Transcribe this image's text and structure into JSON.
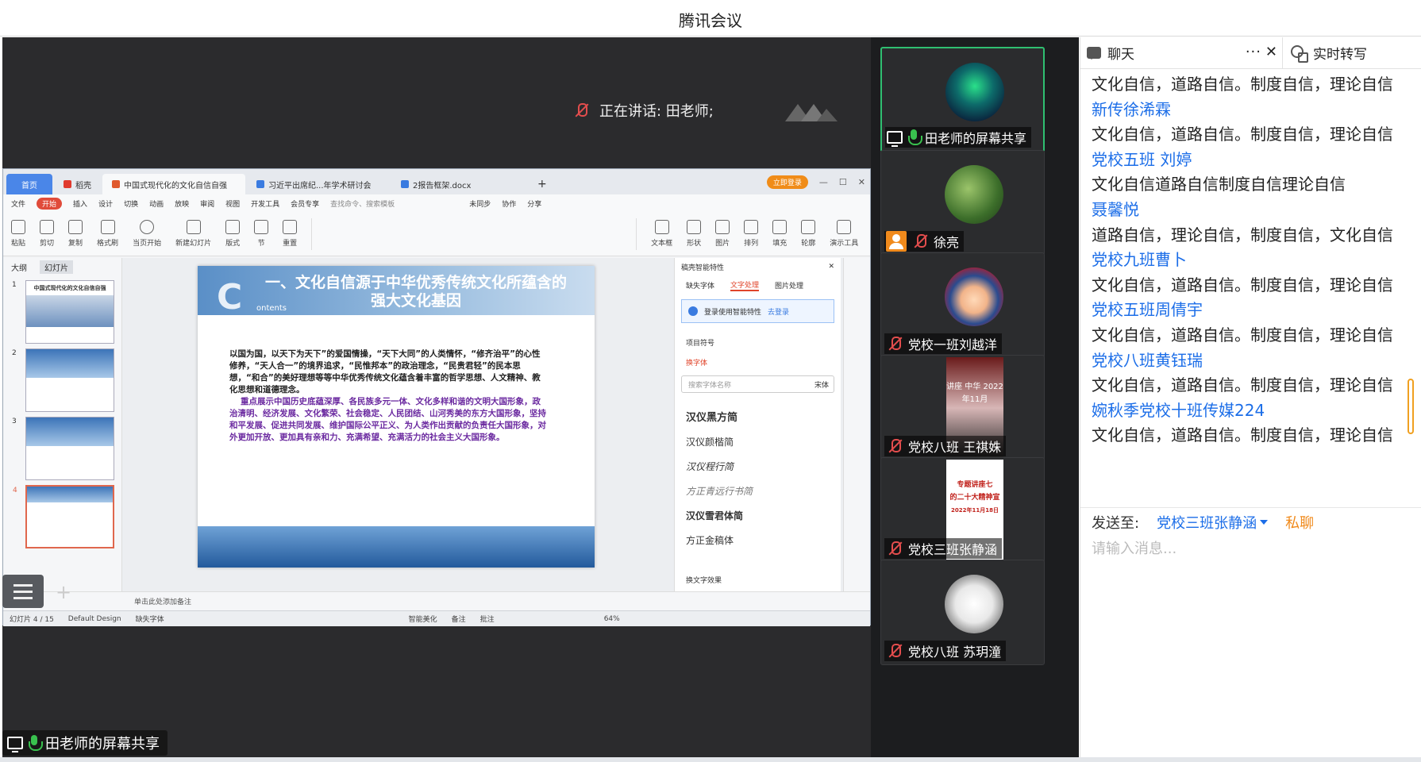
{
  "window": {
    "title": "腾讯会议"
  },
  "stage": {
    "speaking": "正在讲话: 田老师;",
    "share_label": "田老师的屏幕共享"
  },
  "wps": {
    "tabs": [
      "首页",
      "稻壳",
      "中国式现代化的文化自信自强",
      "习近平出席纪...年学术研讨会",
      "2报告框架.docx"
    ],
    "login": "立即登录",
    "menus": [
      "文件",
      "开始",
      "插入",
      "设计",
      "切换",
      "动画",
      "放映",
      "审阅",
      "视图",
      "开发工具",
      "会员专享",
      "查找命令、搜索模板"
    ],
    "menu_right": [
      "未同步",
      "协作",
      "分享"
    ],
    "ribbon": [
      "粘贴",
      "剪切",
      "复制",
      "格式刷",
      "当页开始",
      "新建幻灯片",
      "版式",
      "节",
      "重置",
      "文本框",
      "形状",
      "图片",
      "排列",
      "填充",
      "轮廓",
      "演示工具"
    ],
    "thumb_tabs": [
      "大纲",
      "幻灯片"
    ],
    "thumb_title": "中国式现代化的文化自信自强",
    "slide": {
      "title": "一、文化自信源于中华优秀传统文化所蕴含的强大文化基因",
      "big_c": "C",
      "ontents": "ontents",
      "para1": "以国为国，以天下为天下”的爱国情操，“天下大同”的人类情怀，“修齐治平”的心性修养，“天人合一”的境界追求，“民惟邦本”的政治理念，“民贵君轻”的民本思想，“和合”的美好理想等等中华优秀传统文化蕴含着丰富的哲学思想、人文精神、教化思想和道德理念。",
      "para2": "重点展示中国历史底蕴深厚、各民族多元一体、文化多样和谐的文明大国形象，政治清明、经济发展、文化繁荣、社会稳定、人民团结、山河秀美的东方大国形象，坚持和平发展、促进共同发展、维护国际公平正义、为人类作出贡献的负责任大国形象，对外更加开放、更加具有亲和力、充满希望、充满活力的社会主义大国形象。"
    },
    "panel": {
      "title": "稿壳智能特性",
      "tabs": [
        "缺失字体",
        "文字处理",
        "图片处理"
      ],
      "info": "登录使用智能特性",
      "info_link": "去登录",
      "item1": "项目符号",
      "item2": "换字体",
      "search_placeholder": "搜索字体名称",
      "search_font": "宋体",
      "fonts": [
        "汉仪黑方简",
        "汉仪颜楷简",
        "汉仪程行简",
        "方正青远行书简",
        "汉仪雪君体简",
        "方正金稿体"
      ],
      "effect": "换文字效果"
    },
    "notes": "单击此处添加备注",
    "status": {
      "slide": "幻灯片 4 / 15",
      "theme": "Default Design",
      "missing_font": "缺失字体",
      "beautify": "智能美化",
      "remark": "备注",
      "comment": "批注",
      "zoom": "64%"
    }
  },
  "participants": [
    {
      "name": "田老师的屏幕共享",
      "mic": "on",
      "active": true
    },
    {
      "name": "徐亮",
      "mic": "muted",
      "active": false
    },
    {
      "name": "党校一班刘越洋",
      "mic": "muted",
      "active": false
    },
    {
      "name": "党校八班 王祺姝",
      "mic": "muted",
      "active": false
    },
    {
      "name": "党校三班张静涵",
      "mic": "muted",
      "active": false
    },
    {
      "name": "党校八班 苏玥潼",
      "mic": "muted",
      "active": false
    }
  ],
  "poster_text": {
    "p4": "讲座 中华 2022年11月",
    "p5_line1": "专题讲座七",
    "p5_line2": "的二十大精神宣",
    "p5_line3": "2022年11月18日"
  },
  "chat": {
    "tab_chat": "聊天",
    "tab_transcribe": "实时转写",
    "more": "···",
    "messages": [
      {
        "type": "m",
        "text": "文化自信，道路自信。制度自信，理论自信"
      },
      {
        "type": "n",
        "text": "新传徐浠霖"
      },
      {
        "type": "m",
        "text": "文化自信，道路自信。制度自信，理论自信"
      },
      {
        "type": "n",
        "text": "党校五班 刘婷"
      },
      {
        "type": "m",
        "text": "文化自信道路自信制度自信理论自信"
      },
      {
        "type": "n",
        "text": "聂馨悦"
      },
      {
        "type": "m",
        "text": "道路自信，理论自信，制度自信，文化自信"
      },
      {
        "type": "n",
        "text": "党校九班曹卜"
      },
      {
        "type": "m",
        "text": "文化自信，道路自信。制度自信，理论自信"
      },
      {
        "type": "n",
        "text": "党校五班周倩宇"
      },
      {
        "type": "m",
        "text": "文化自信，道路自信。制度自信，理论自信"
      },
      {
        "type": "n",
        "text": "党校八班黄钰瑞"
      },
      {
        "type": "m",
        "text": "文化自信，道路自信。制度自信，理论自信"
      },
      {
        "type": "n",
        "text": "婉秋季党校十班传媒224"
      },
      {
        "type": "m",
        "text": "文化自信，道路自信。制度自信，理论自信"
      }
    ],
    "send_to_label": "发送至:",
    "send_to_value": "党校三班张静涵",
    "private": "私聊",
    "input_placeholder": "请输入消息..."
  },
  "colors": {
    "accent": "#1c6ee8",
    "active_border": "#2fbf71",
    "muted": "#e34d4d",
    "private": "#f08a1c"
  }
}
